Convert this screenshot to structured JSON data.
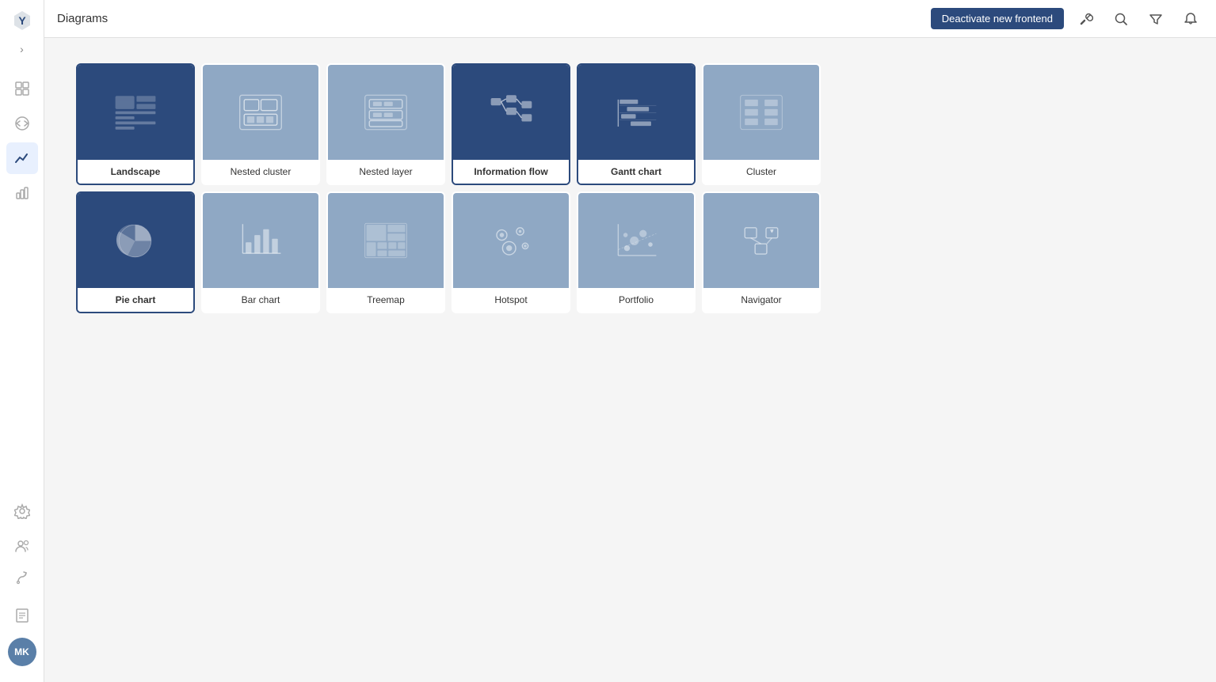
{
  "app": {
    "logo": "Y",
    "expand_icon": "›",
    "title": "Diagrams"
  },
  "topbar": {
    "title": "Diagrams",
    "deactivate_btn": "Deactivate new frontend"
  },
  "sidebar": {
    "nav_items": [
      {
        "id": "dashboard",
        "icon": "grid",
        "active": false
      },
      {
        "id": "code",
        "icon": "code",
        "active": false
      },
      {
        "id": "diagrams",
        "icon": "chart-line",
        "active": true
      },
      {
        "id": "bar-chart",
        "icon": "bar-chart",
        "active": false
      },
      {
        "id": "spacer",
        "icon": "",
        "active": false
      },
      {
        "id": "settings",
        "icon": "settings",
        "active": false
      },
      {
        "id": "users",
        "icon": "users",
        "active": false
      }
    ],
    "bottom_items": [
      {
        "id": "flow",
        "icon": "flow"
      },
      {
        "id": "book",
        "icon": "book"
      }
    ],
    "avatar": "MK"
  },
  "diagrams": {
    "rows": [
      [
        {
          "id": "landscape",
          "label": "Landscape",
          "bold": true,
          "dark": true
        },
        {
          "id": "nested-cluster",
          "label": "Nested cluster",
          "bold": false,
          "dark": false
        },
        {
          "id": "nested-layer",
          "label": "Nested layer",
          "bold": false,
          "dark": false
        },
        {
          "id": "information-flow",
          "label": "Information flow",
          "bold": true,
          "dark": true
        },
        {
          "id": "gantt-chart",
          "label": "Gantt chart",
          "bold": true,
          "dark": true
        },
        {
          "id": "cluster",
          "label": "Cluster",
          "bold": false,
          "dark": false
        }
      ],
      [
        {
          "id": "pie-chart",
          "label": "Pie chart",
          "bold": true,
          "dark": true
        },
        {
          "id": "bar-chart",
          "label": "Bar chart",
          "bold": false,
          "dark": false
        },
        {
          "id": "treemap",
          "label": "Treemap",
          "bold": false,
          "dark": false
        },
        {
          "id": "hotspot",
          "label": "Hotspot",
          "bold": false,
          "dark": false
        },
        {
          "id": "portfolio",
          "label": "Portfolio",
          "bold": false,
          "dark": false
        },
        {
          "id": "navigator",
          "label": "Navigator",
          "bold": false,
          "dark": false
        }
      ]
    ]
  }
}
